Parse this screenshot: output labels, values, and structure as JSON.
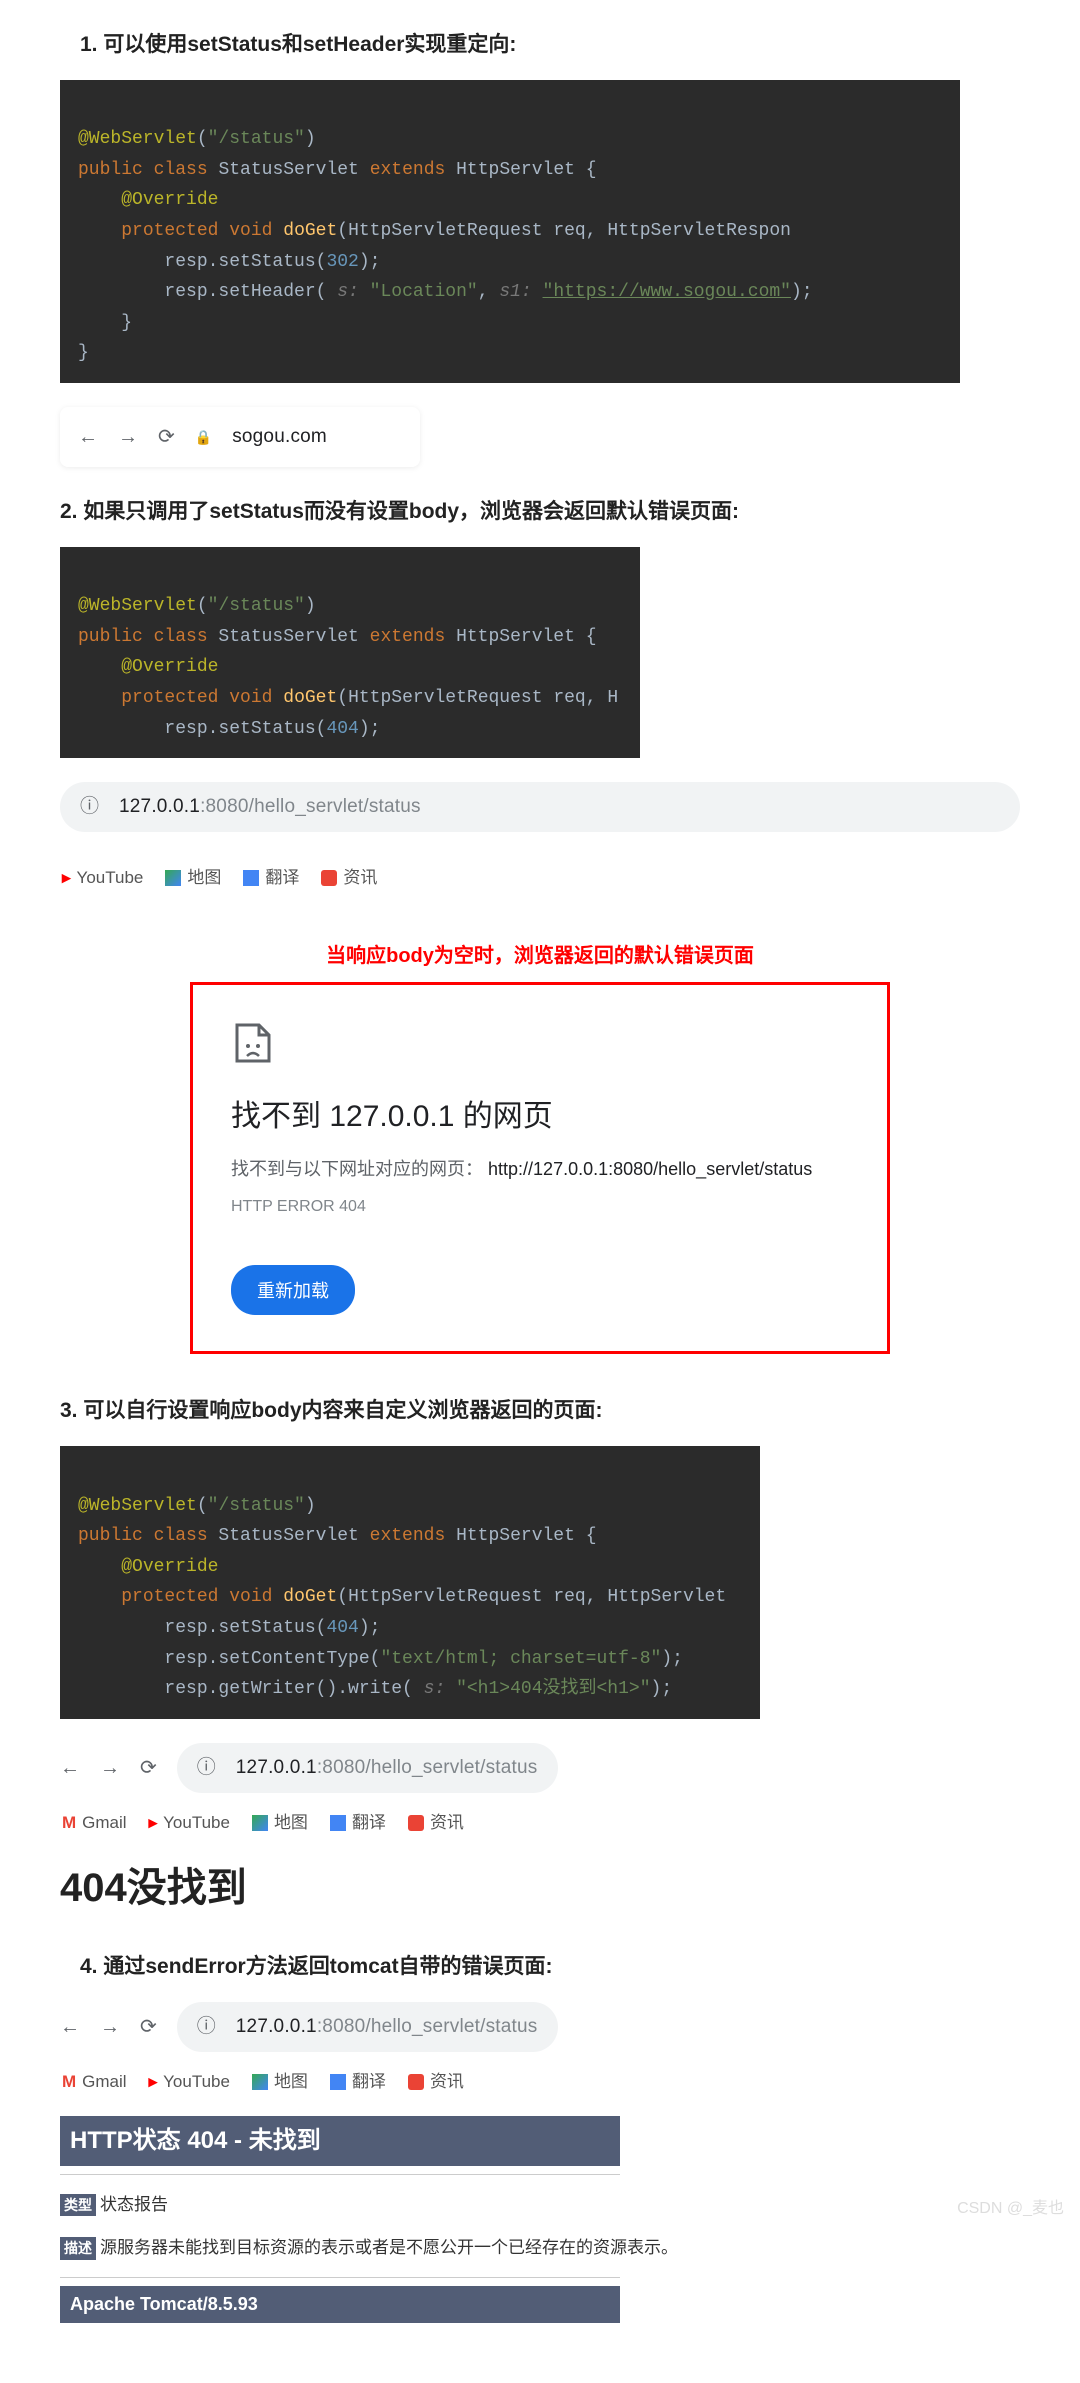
{
  "sections": {
    "s1": {
      "title": "1. 可以使用setStatus和setHeader实现重定向:",
      "code_lines": [
        "@WebServlet(\"/status\")",
        "public class StatusServlet extends HttpServlet {",
        "    @Override",
        "    protected void doGet(HttpServletRequest req, HttpServletRespon",
        "        resp.setStatus(302);",
        "        resp.setHeader( s: \"Location\", s1: \"https://www.sogou.com\");",
        "    }",
        "}"
      ],
      "addr": "sogou.com"
    },
    "s2": {
      "title": "2. 如果只调用了setStatus而没有设置body，浏览器会返回默认错误页面:",
      "addr_pre": "127.0.0.1",
      "addr_rest": ":8080/hello_servlet/status",
      "bookmarks": [
        "YouTube",
        "地图",
        "翻译",
        "资讯"
      ],
      "red_caption": "当响应body为空时，浏览器返回的默认错误页面",
      "err_title": "找不到 127.0.0.1 的网页",
      "err_sub_pre": "找不到与以下网址对应的网页：",
      "err_sub_url": "http://127.0.0.1:8080/hello_servlet/status",
      "err_code": "HTTP ERROR 404",
      "reload": "重新加载"
    },
    "s3": {
      "title": "3. 可以自行设置响应body内容来自定义浏览器返回的页面:",
      "addr_pre": "127.0.0.1",
      "addr_rest": ":8080/hello_servlet/status",
      "bookmarks": [
        "Gmail",
        "YouTube",
        "地图",
        "翻译",
        "资讯"
      ],
      "big404": "404没找到"
    },
    "s4": {
      "title": "4. 通过sendError方法返回tomcat自带的错误页面:",
      "addr_pre": "127.0.0.1",
      "addr_rest": ":8080/hello_servlet/status",
      "bookmarks": [
        "Gmail",
        "YouTube",
        "地图",
        "翻译",
        "资讯"
      ],
      "tomcat_title": "HTTP状态 404 - 未找到",
      "tag1": "类型",
      "text1": "状态报告",
      "tag2": "描述",
      "text2": "源服务器未能找到目标资源的表示或者是不愿公开一个已经存在的资源表示。",
      "footer": "Apache Tomcat/8.5.93"
    }
  },
  "watermark": "CSDN @_麦也"
}
